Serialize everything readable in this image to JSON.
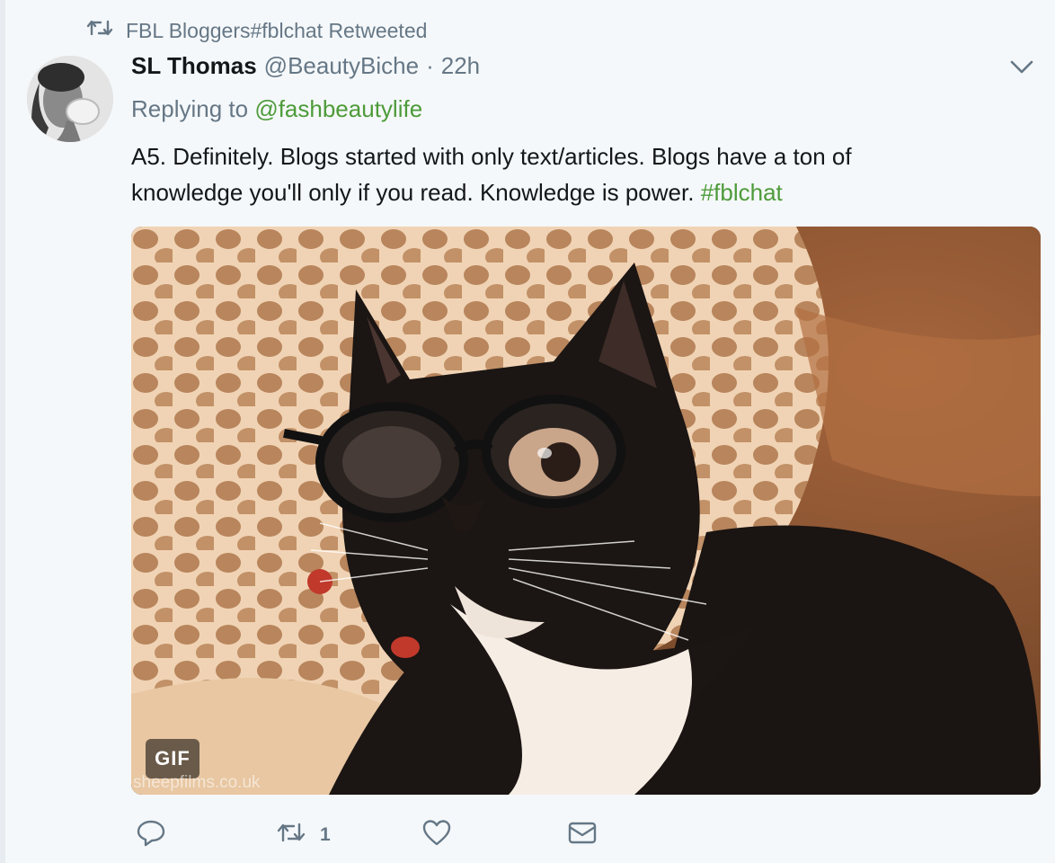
{
  "retweet_context": {
    "text": "FBL Bloggers#fblchat Retweeted",
    "icon": "retweet-icon"
  },
  "author": {
    "fullname": "SL Thomas",
    "handle": "@BeautyBiche",
    "separator": "·",
    "time": "22h"
  },
  "reply_context": {
    "prefix": "Replying to ",
    "mention": "@fashbeautylife"
  },
  "tweet": {
    "text": "A5. Definitely. Blogs started with only text/articles. Blogs have a ton of knowledge you'll only if you read. Knowledge is power. ",
    "hashtag": "#fblchat"
  },
  "media": {
    "badge": "GIF",
    "watermark": "sheepfilms.co.uk"
  },
  "actions": {
    "reply_icon": "reply-icon",
    "retweet_icon": "retweet-icon",
    "retweet_count": "1",
    "like_icon": "heart-icon",
    "dm_icon": "envelope-icon"
  },
  "colors": {
    "link": "#4d9b3a",
    "secondary_text": "#657786",
    "primary_text": "#14171a",
    "background": "#f5f8fa"
  }
}
